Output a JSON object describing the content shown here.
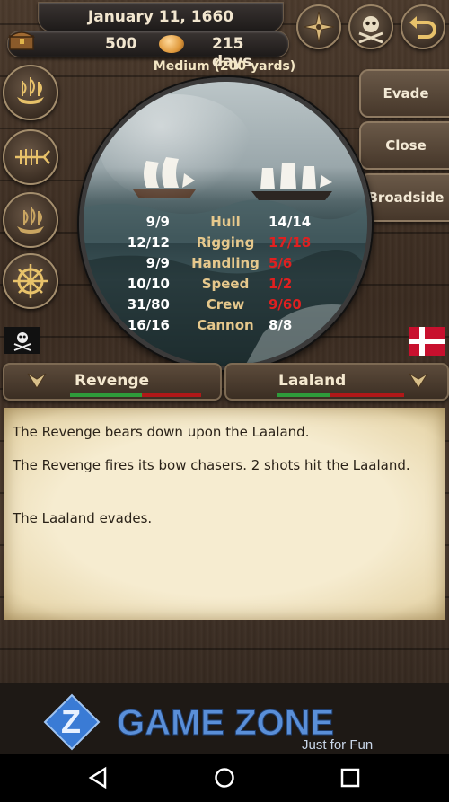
{
  "header": {
    "date": "January 11, 1660",
    "gold": "500",
    "days": "215 days"
  },
  "battle": {
    "range": "Medium (200 yards)",
    "actions": [
      "Evade",
      "Close",
      "Broadside"
    ]
  },
  "stats": [
    {
      "left": "9/9",
      "name": "Hull",
      "right": "14/14",
      "right_damaged": false
    },
    {
      "left": "12/12",
      "name": "Rigging",
      "right": "17/18",
      "right_damaged": true
    },
    {
      "left": "9/9",
      "name": "Handling",
      "right": "5/6",
      "right_damaged": true
    },
    {
      "left": "10/10",
      "name": "Speed",
      "right": "1/2",
      "right_damaged": true
    },
    {
      "left": "31/80",
      "name": "Crew",
      "right": "9/60",
      "right_damaged": true
    },
    {
      "left": "16/16",
      "name": "Cannon",
      "right": "8/8",
      "right_damaged": false
    }
  ],
  "ships": {
    "player": {
      "name": "Revenge",
      "health": 0.45,
      "flag": "pirate-flag"
    },
    "enemy": {
      "name": "Laaland",
      "health": 0.45,
      "flag": "danish-flag"
    }
  },
  "log": [
    "The Revenge bears down upon the Laaland.",
    "The Revenge fires its bow chasers. 2 shots hit the Laaland.",
    "The Laaland evades."
  ],
  "watermark": {
    "brand": "GAME ZONE",
    "tagline": "Just for Fun"
  },
  "colors": {
    "damaged": "#e02020",
    "healthy": "#2e9b3a",
    "hurt": "#b01818"
  }
}
